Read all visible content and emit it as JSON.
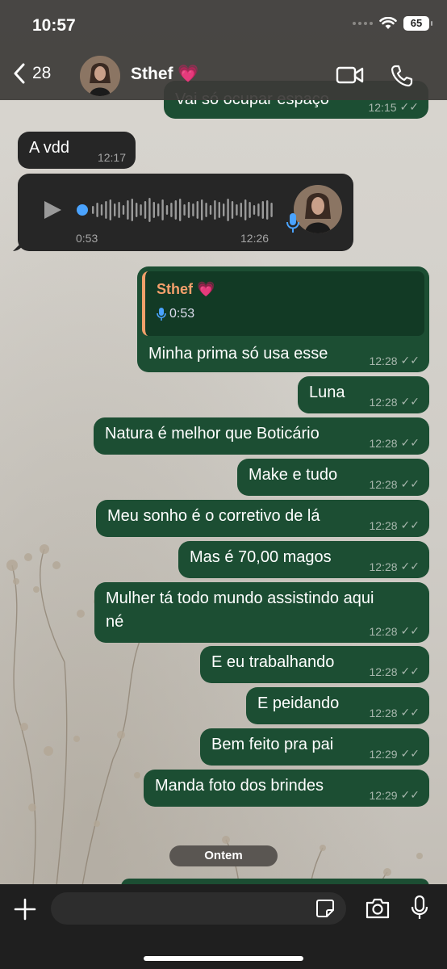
{
  "status_bar": {
    "time": "10:57",
    "battery": "65"
  },
  "header": {
    "back_count": "28",
    "contact_name": "Sthef 💗"
  },
  "messages": [
    {
      "text": "Vai só ocupar espaço",
      "time": "12:15"
    },
    {
      "text": "A vdd",
      "time": "12:17"
    },
    {
      "audio_position": "0:53",
      "time": "12:26",
      "progress": 0
    },
    {
      "reply_name": "Sthef 💗",
      "reply_duration": "0:53",
      "text": "Minha prima só usa esse",
      "time": "12:28"
    },
    {
      "text": "Luna",
      "time": "12:28"
    },
    {
      "text": "Natura é melhor que Boticário",
      "time": "12:28"
    },
    {
      "text": "Make e tudo",
      "time": "12:28"
    },
    {
      "text": "Meu sonho é o corretivo de lá",
      "time": "12:28"
    },
    {
      "text": "Mas é 70,00 magos",
      "time": "12:28"
    },
    {
      "text_line1": "Mulher tá todo mundo assistindo aqui",
      "text_line2": "né",
      "time": "12:28"
    },
    {
      "text": "E eu trabalhando",
      "time": "12:28"
    },
    {
      "text": "E peidando",
      "time": "12:28"
    },
    {
      "text": "Bem feito pra pai",
      "time": "12:29"
    },
    {
      "text": "Manda foto dos brindes",
      "time": "12:29"
    }
  ],
  "date_separator": "Ontem",
  "colors": {
    "outgoing_bubble": "#1c4e33",
    "incoming_bubble": "#262626",
    "reply_accent": "#f5a06c",
    "audio_accent": "#4aa3ff"
  }
}
